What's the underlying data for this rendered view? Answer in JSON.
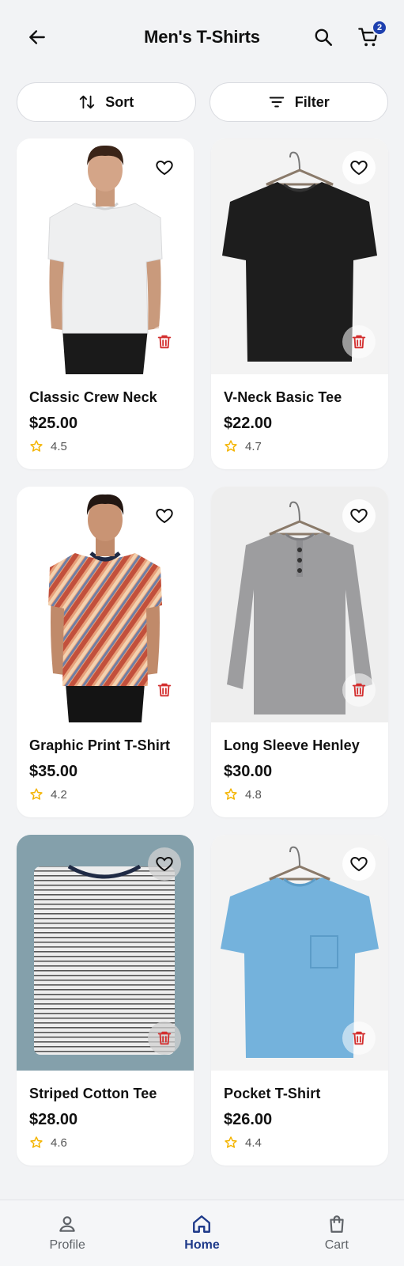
{
  "header": {
    "title": "Men's T-Shirts",
    "cart_count": "2",
    "icons": [
      "arrow-left-icon",
      "search-icon",
      "cart-icon"
    ]
  },
  "controls": {
    "sort_label": "Sort",
    "filter_label": "Filter"
  },
  "products": [
    {
      "name": "Classic Crew Neck",
      "price": "$25.00",
      "rating": "4.5"
    },
    {
      "name": "V-Neck Basic Tee",
      "price": "$22.00",
      "rating": "4.7"
    },
    {
      "name": "Graphic Print T-Shirt",
      "price": "$35.00",
      "rating": "4.2"
    },
    {
      "name": "Long Sleeve Henley",
      "price": "$30.00",
      "rating": "4.8"
    },
    {
      "name": "Striped Cotton Tee",
      "price": "$28.00",
      "rating": "4.6"
    },
    {
      "name": "Pocket T-Shirt",
      "price": "$26.00",
      "rating": "4.4"
    }
  ],
  "nav": {
    "items": [
      {
        "label": "Profile",
        "icon": "person-icon"
      },
      {
        "label": "Home",
        "icon": "home-icon"
      },
      {
        "label": "Cart",
        "icon": "shopping-bag-icon"
      }
    ],
    "active": "Home"
  },
  "colors": {
    "accent": "#1e3a8a",
    "badge": "#1e40af",
    "delete": "#d32f2f",
    "star": "#f4b400"
  }
}
